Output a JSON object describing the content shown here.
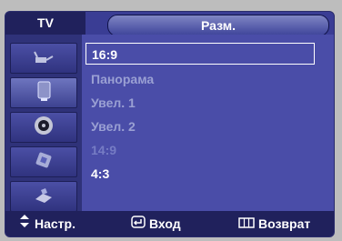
{
  "window": {
    "tv_label": "TV",
    "tab_title": "Разм."
  },
  "sidebar": {
    "icons": [
      "antenna-icon",
      "picture-icon",
      "sound-icon",
      "channel-icon",
      "setup-icon"
    ],
    "active_index": 1
  },
  "menu": {
    "items": [
      {
        "label": "16:9",
        "state": "selected"
      },
      {
        "label": "Панорама",
        "state": "dim"
      },
      {
        "label": "Увел. 1",
        "state": "dim"
      },
      {
        "label": "Увел. 2",
        "state": "dim"
      },
      {
        "label": "14:9",
        "state": "disabled"
      },
      {
        "label": "4:3",
        "state": "bright"
      }
    ]
  },
  "footer": {
    "move_label": "Настр.",
    "enter_label": "Вход",
    "return_label": "Возврат"
  },
  "colors": {
    "accent": "#3a3d94",
    "header": "#20215c"
  }
}
